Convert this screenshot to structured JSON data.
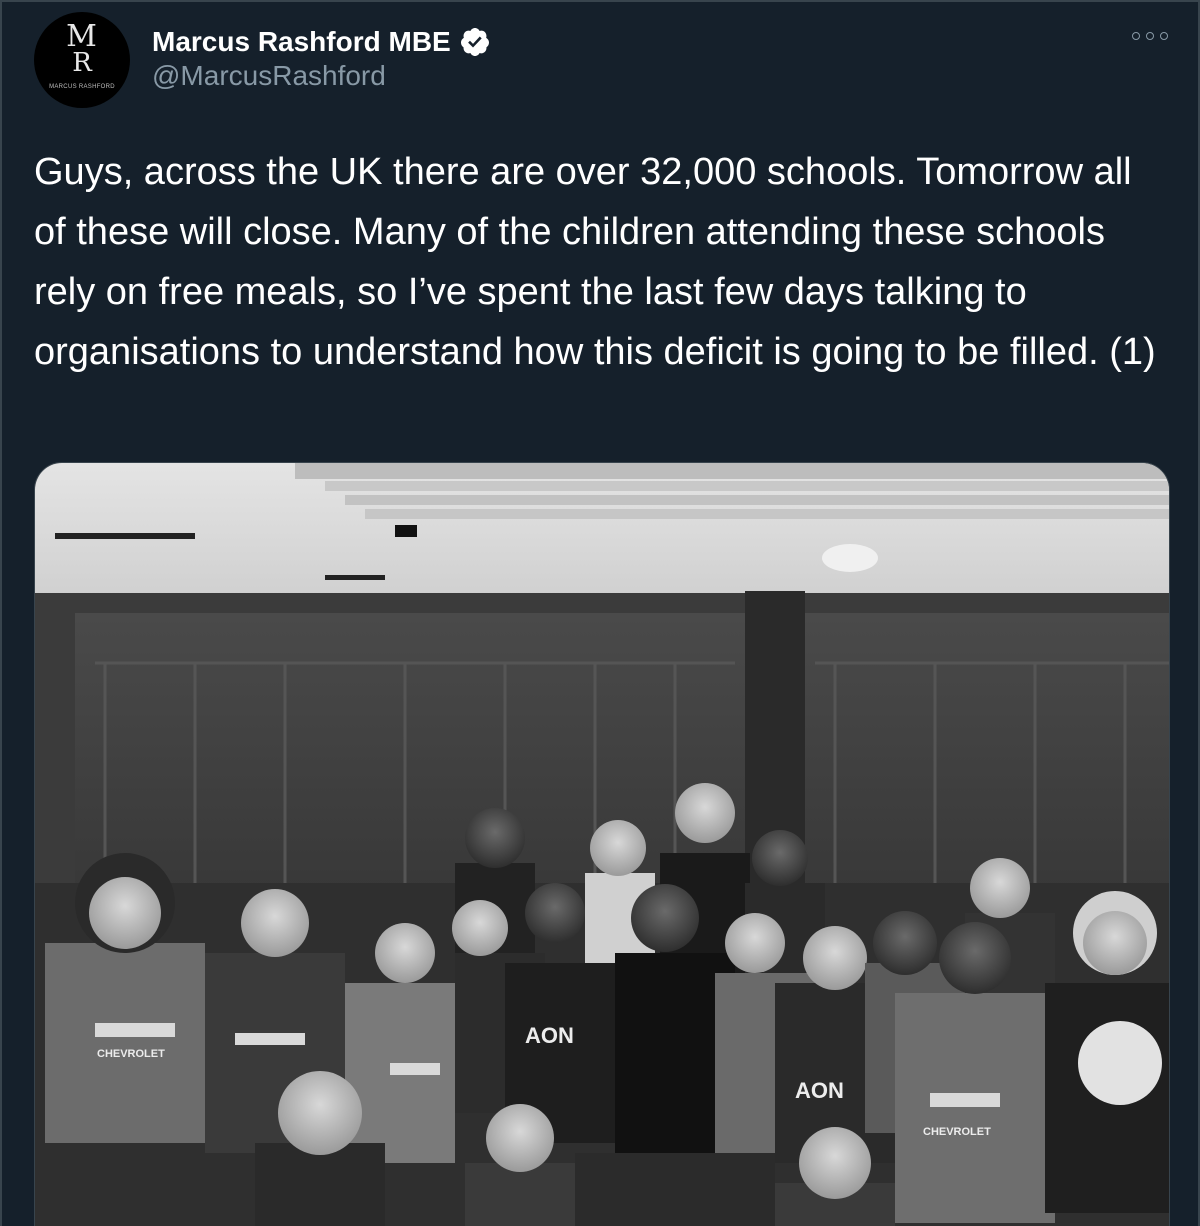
{
  "tweet": {
    "author": {
      "display_name": "Marcus Rashford MBE",
      "handle": "@MarcusRashford",
      "avatar_monogram_top": "M",
      "avatar_monogram_bottom": "R",
      "avatar_brand_text": "MARCUS RASHFORD",
      "verified": true
    },
    "text": "Guys, across the UK there are over 32,000 schools. Tomorrow all of these will close. Many of the children attending these schools rely on free meals, so I’ve spent the last few days talking to organisations to understand how this deficit is going to be filled. (1)",
    "media": {
      "kind": "black-and-white group photo",
      "shirt_sponsor": "CHEVROLET",
      "shirt_sponsor_alt": "AON"
    }
  },
  "colors": {
    "background": "#15202b",
    "text_primary": "#ffffff",
    "text_secondary": "#8899a6",
    "verified_badge": "#ffffff",
    "border": "#38444d"
  },
  "icons": {
    "verified": "verified-badge-icon",
    "more": "more-options-icon"
  }
}
